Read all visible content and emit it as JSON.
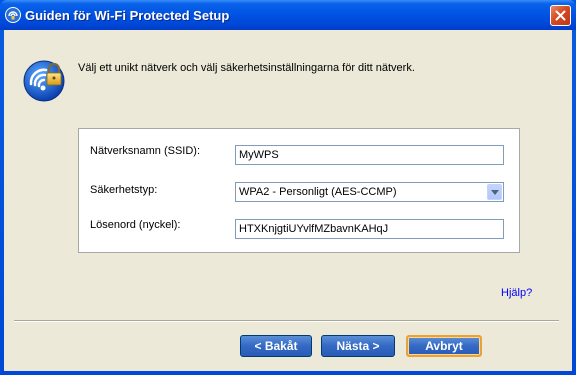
{
  "window": {
    "title": "Guiden för Wi-Fi Protected Setup",
    "icon": "wps-icon",
    "close_icon": "close-icon"
  },
  "header": {
    "icon": "wifi-lock-icon",
    "instruction": "Välj ett unikt nätverk och välj säkerhetsinställningarna för ditt nätverk."
  },
  "form": {
    "ssid_label": "Nätverksnamn (SSID):",
    "ssid_value": "MyWPS",
    "security_label": "Säkerhetstyp:",
    "security_value": "WPA2 - Personligt (AES-CCMP)",
    "password_label": "Lösenord (nyckel):",
    "password_value": "HTXKnjgtiUYvlfMZbavnKAHqJ"
  },
  "help_link": "Hjälp?",
  "buttons": {
    "back": "< Bakåt",
    "next": "Nästa >",
    "cancel": "Avbryt"
  },
  "colors": {
    "title_bar": "#0055e4",
    "client_bg": "#ece9d8",
    "button_blue": "#3469c4",
    "default_button_border": "#e8a23a",
    "link": "#0000ff"
  }
}
